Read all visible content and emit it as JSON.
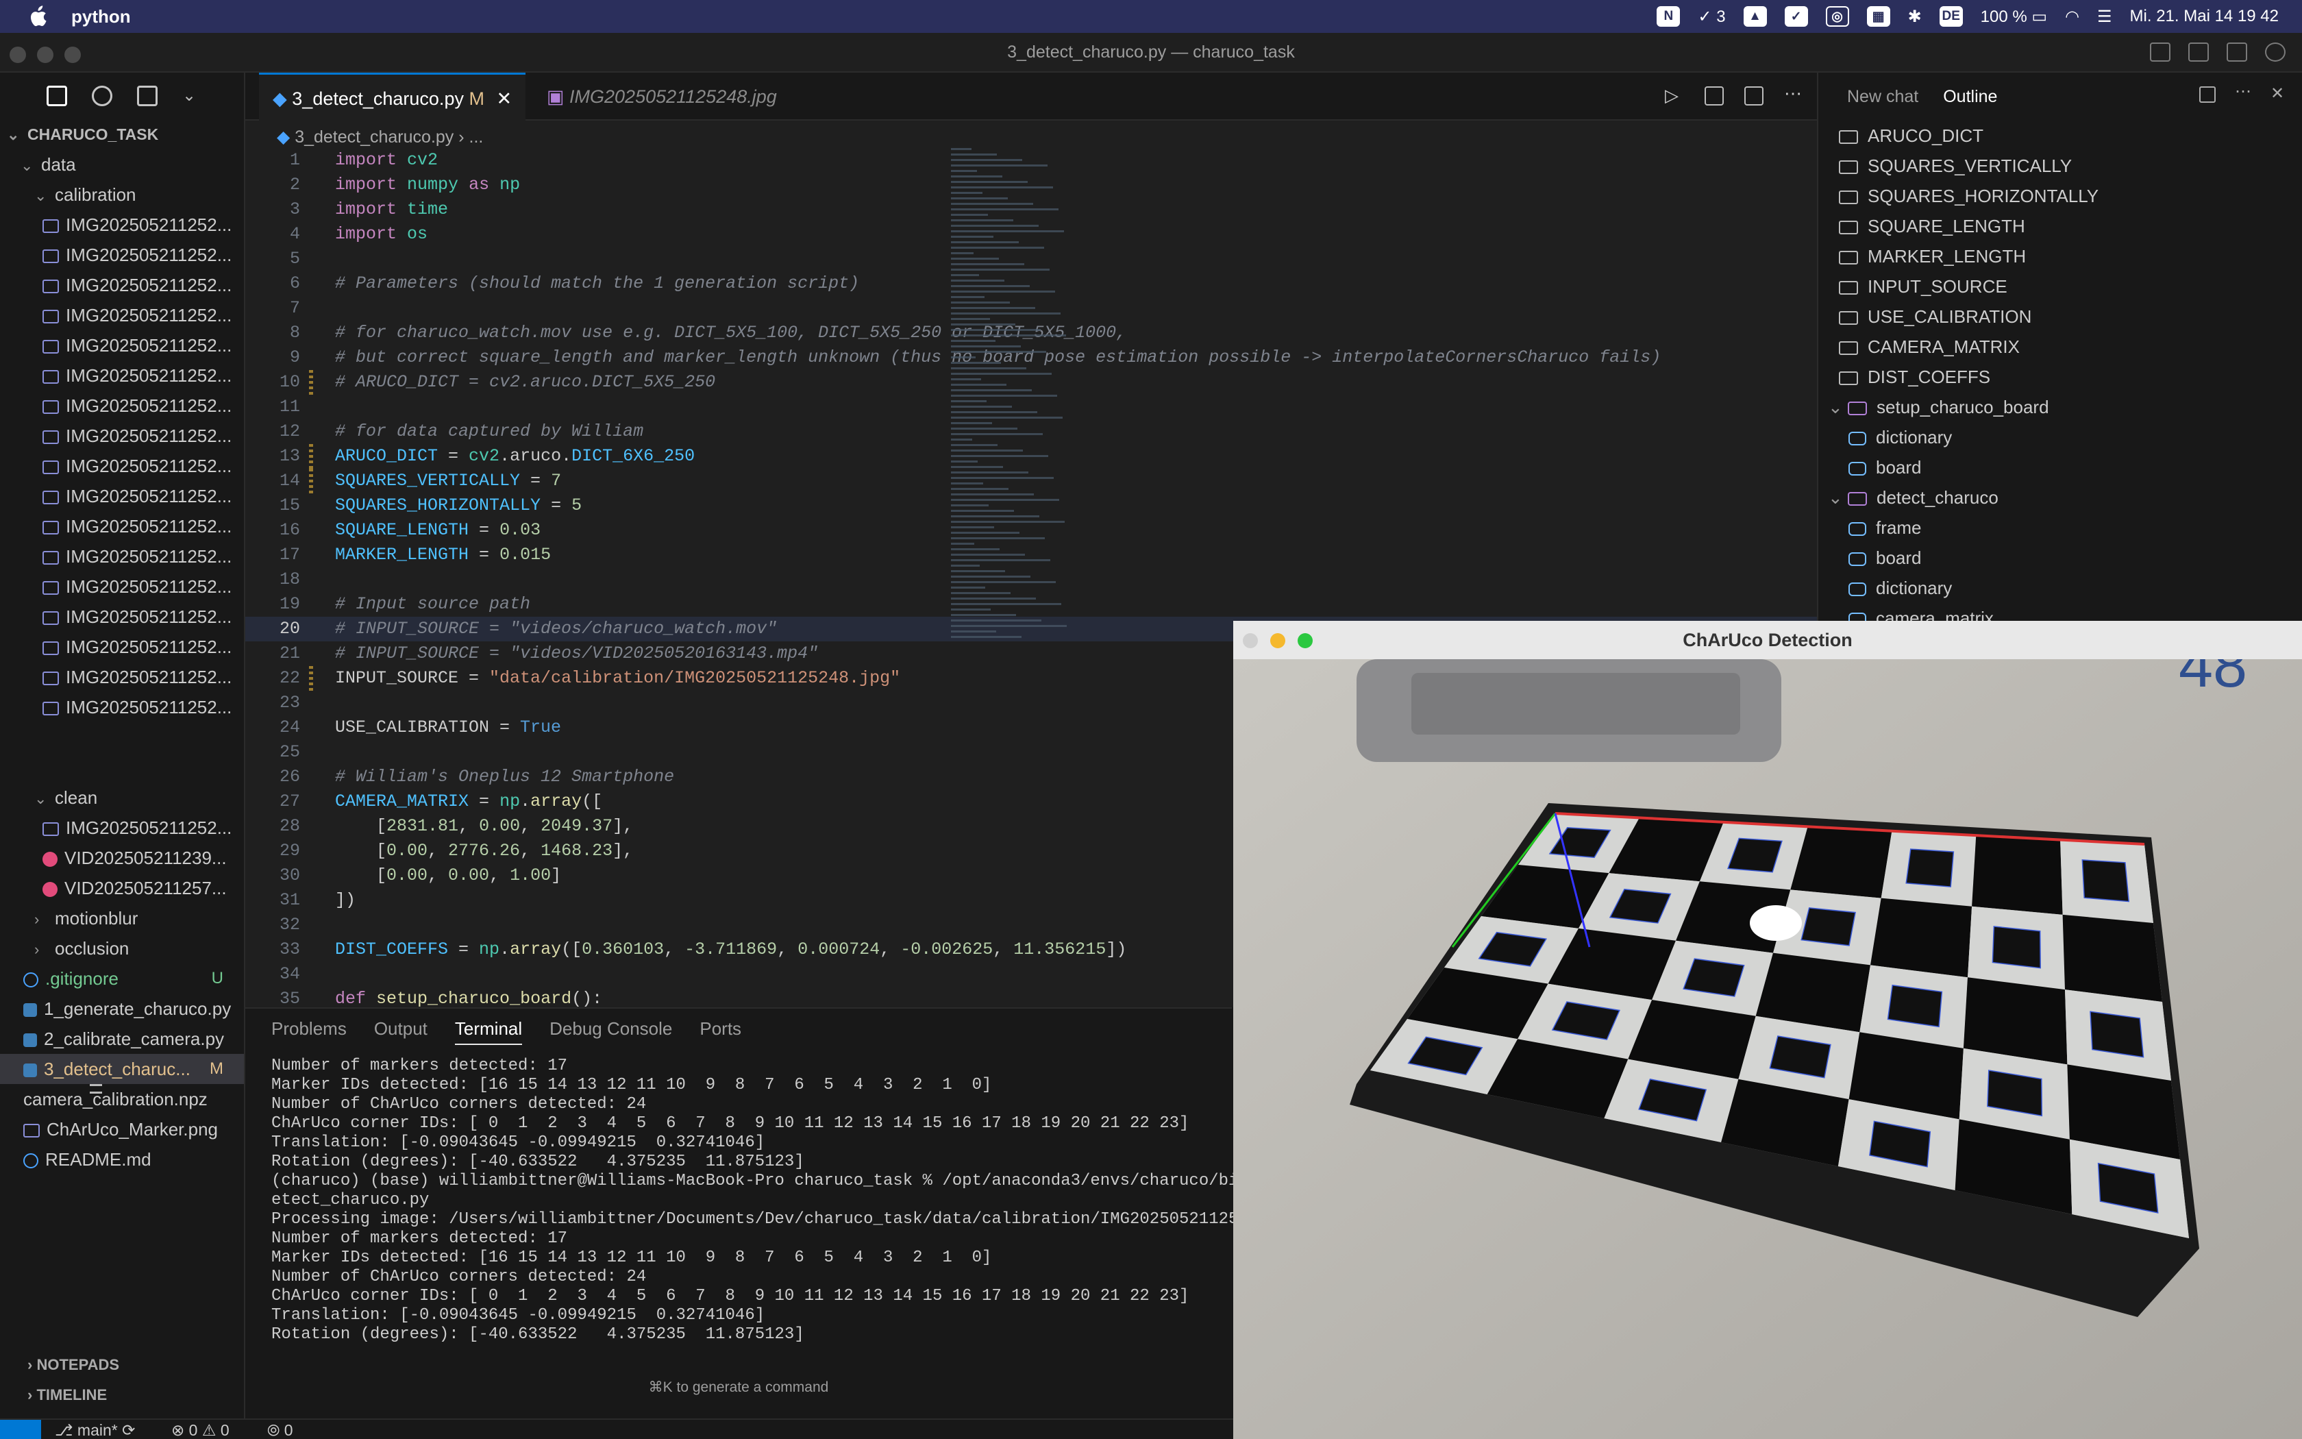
{
  "menubar": {
    "app": "python",
    "right": [
      "N",
      "3",
      "100 %",
      "DE",
      "Mi. 21. Mai 14 19 42"
    ]
  },
  "window": {
    "title": "3_detect_charuco.py — charuco_task"
  },
  "sidebar": {
    "root": "CHARUCO_TASK",
    "folders": {
      "data": "data",
      "calibration": "calibration",
      "clean": "clean",
      "motionblur": "motionblur",
      "occlusion": "occlusion"
    },
    "cal_item": "IMG202505211252...",
    "clean_items": [
      "IMG202505211252...",
      "VID202505211239...",
      "VID202505211257..."
    ],
    "files": [
      {
        "name": ".gitignore",
        "badge": "U"
      },
      {
        "name": "1_generate_charuco.py",
        "badge": ""
      },
      {
        "name": "2_calibrate_camera.py",
        "badge": ""
      },
      {
        "name": "3_detect_charuc...",
        "badge": "M"
      },
      {
        "name": "camera_calibration.npz",
        "badge": ""
      },
      {
        "name": "ChArUco_Marker.png",
        "badge": ""
      },
      {
        "name": "README.md",
        "badge": ""
      }
    ],
    "notepads": "NOTEPADS",
    "timeline": "TIMELINE"
  },
  "editor": {
    "tab_active": "3_detect_charuco.py",
    "tab_active_badge": "M",
    "tab_other": "IMG20250521125248.jpg",
    "breadcrumb": "3_detect_charuco.py",
    "breadcrumb_more": "..."
  },
  "code_lines": [
    "import cv2",
    "import numpy as np",
    "import time",
    "import os",
    "",
    "# Parameters (should match the 1 generation script)",
    "",
    "# for charuco_watch.mov use e.g. DICT_5X5_100, DICT_5X5_250 or DICT_5X5_1000,",
    "# but correct square_length and marker_length unknown (thus no board pose estimation possible -> interpolateCornersCharuco fails)",
    "# ARUCO_DICT = cv2.aruco.DICT_5X5_250",
    "",
    "# for data captured by William",
    "ARUCO_DICT = cv2.aruco.DICT_6X6_250",
    "SQUARES_VERTICALLY = 7",
    "SQUARES_HORIZONTALLY = 5",
    "SQUARE_LENGTH = 0.03",
    "MARKER_LENGTH = 0.015",
    "",
    "# Input source path",
    "# INPUT_SOURCE = \"videos/charuco_watch.mov\"",
    "# INPUT_SOURCE = \"videos/VID20250520163143.mp4\"",
    "INPUT_SOURCE = \"data/calibration/IMG20250521125248.jpg\"",
    "",
    "USE_CALIBRATION = True",
    "",
    "# William's Oneplus 12 Smartphone",
    "CAMERA_MATRIX = np.array([",
    "    [2831.81, 0.00, 2049.37],",
    "    [0.00, 2776.26, 1468.23],",
    "    [0.00, 0.00, 1.00]",
    "])",
    "",
    "DIST_COEFFS = np.array([0.360103, -3.711869, 0.000724, -0.002625, 11.356215])",
    "",
    "def setup_charuco_board():"
  ],
  "panel": {
    "tabs": [
      "Problems",
      "Output",
      "Terminal",
      "Debug Console",
      "Ports"
    ],
    "active_tab": "Terminal",
    "terminal_lines": [
      "Number of markers detected: 17",
      "Marker IDs detected: [16 15 14 13 12 11 10  9  8  7  6  5  4  3  2  1  0]",
      "Number of ChArUco corners detected: 24",
      "ChArUco corner IDs: [ 0  1  2  3  4  5  6  7  8  9 10 11 12 13 14 15 16 17 18 19 20 21 22 23]",
      "Translation: [-0.09043645 -0.09949215  0.32741046]",
      "Rotation (degrees): [-40.633522   4.375235  11.875123]",
      "(charuco) (base) williambittner@Williams-MacBook-Pro charuco_task % /opt/anaconda3/envs/charuco/bin/",
      "etect_charuco.py",
      "Processing image: /Users/williambittner/Documents/Dev/charuco_task/data/calibration/IMG2025052112524",
      "Number of markers detected: 17",
      "Marker IDs detected: [16 15 14 13 12 11 10  9  8  7  6  5  4  3  2  1  0]",
      "Number of ChArUco corners detected: 24",
      "ChArUco corner IDs: [ 0  1  2  3  4  5  6  7  8  9 10 11 12 13 14 15 16 17 18 19 20 21 22 23]",
      "Translation: [-0.09043645 -0.09949215  0.32741046]",
      "Rotation (degrees): [-40.633522   4.375235  11.875123]"
    ],
    "hint": "⌘K to generate a command"
  },
  "right_panel": {
    "tabs": [
      "New chat",
      "Outline"
    ],
    "active_tab": "Outline",
    "outline": [
      {
        "label": "ARUCO_DICT",
        "kind": "const",
        "indent": 0
      },
      {
        "label": "SQUARES_VERTICALLY",
        "kind": "const",
        "indent": 0
      },
      {
        "label": "SQUARES_HORIZONTALLY",
        "kind": "const",
        "indent": 0
      },
      {
        "label": "SQUARE_LENGTH",
        "kind": "const",
        "indent": 0
      },
      {
        "label": "MARKER_LENGTH",
        "kind": "const",
        "indent": 0
      },
      {
        "label": "INPUT_SOURCE",
        "kind": "const",
        "indent": 0
      },
      {
        "label": "USE_CALIBRATION",
        "kind": "const",
        "indent": 0
      },
      {
        "label": "CAMERA_MATRIX",
        "kind": "const",
        "indent": 0
      },
      {
        "label": "DIST_COEFFS",
        "kind": "const",
        "indent": 0
      },
      {
        "label": "setup_charuco_board",
        "kind": "function",
        "indent": 0
      },
      {
        "label": "dictionary",
        "kind": "var",
        "indent": 1
      },
      {
        "label": "board",
        "kind": "var",
        "indent": 1
      },
      {
        "label": "detect_charuco",
        "kind": "function",
        "indent": 0
      },
      {
        "label": "frame",
        "kind": "var",
        "indent": 1
      },
      {
        "label": "board",
        "kind": "var",
        "indent": 1
      },
      {
        "label": "dictionary",
        "kind": "var",
        "indent": 1
      },
      {
        "label": "camera_matrix",
        "kind": "var",
        "indent": 1
      }
    ]
  },
  "detection_window": {
    "title": "ChArUco Detection"
  },
  "statusbar": {
    "branch": "main*",
    "errors": "0",
    "warnings": "0",
    "ports": "0"
  }
}
